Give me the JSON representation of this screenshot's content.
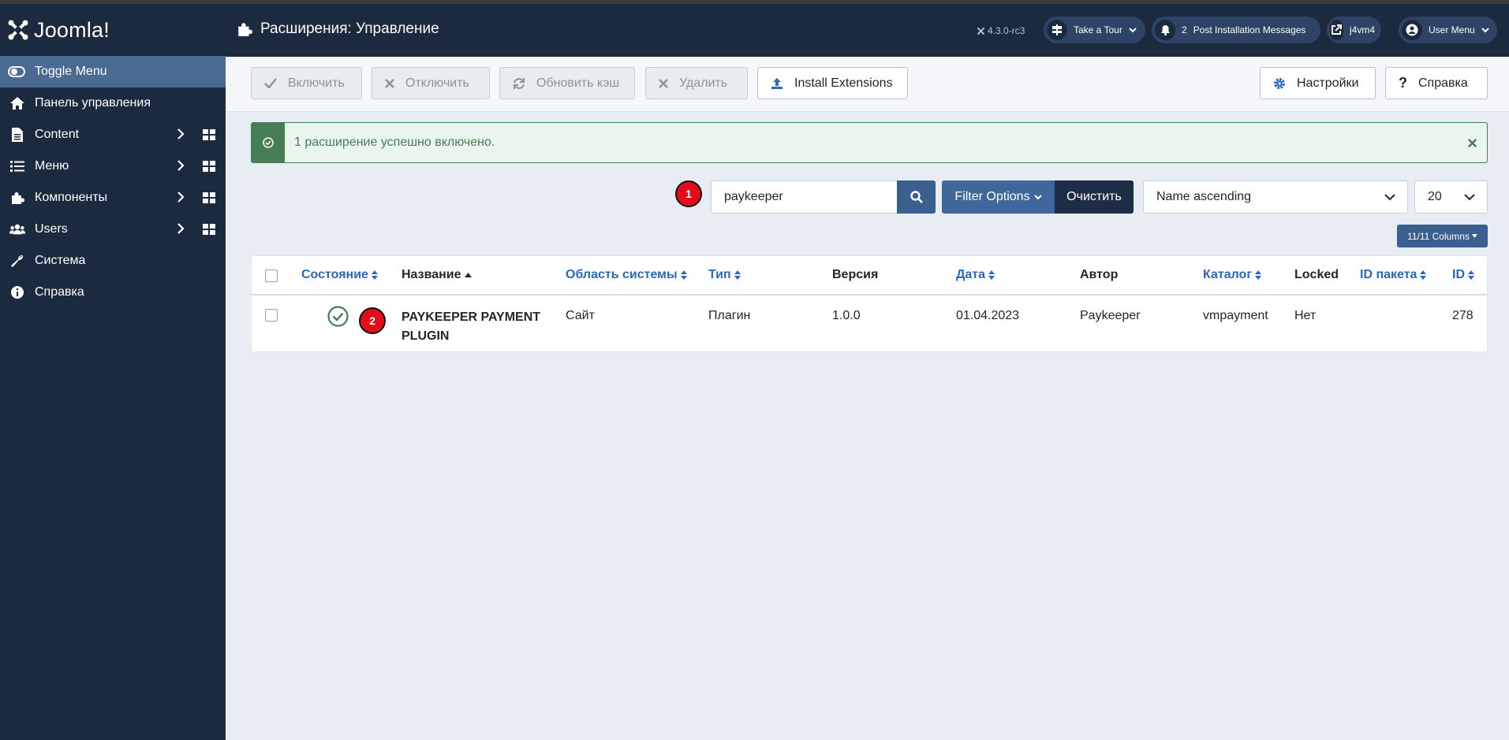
{
  "app": {
    "logo_text": "Joomla!",
    "page_title": "Расширения: Управление",
    "version": "4.3.0-rc3"
  },
  "header_buttons": {
    "tour": "Take a Tour",
    "notifications_count": "2",
    "post_install": "Post Installation Messages",
    "site_name": "j4vm4",
    "user_menu": "User Menu"
  },
  "sidebar": {
    "toggle": "Toggle Menu",
    "items": [
      {
        "label": "Панель управления",
        "icon": "home-icon"
      },
      {
        "label": "Content",
        "icon": "file-icon"
      },
      {
        "label": "Меню",
        "icon": "list-icon"
      },
      {
        "label": "Компоненты",
        "icon": "puzzle-icon"
      },
      {
        "label": "Users",
        "icon": "users-icon"
      },
      {
        "label": "Система",
        "icon": "wrench-icon"
      },
      {
        "label": "Справка",
        "icon": "info-icon"
      }
    ]
  },
  "toolbar": {
    "enable": "Включить",
    "disable": "Отключить",
    "refresh_cache": "Обновить кэш",
    "delete": "Удалить",
    "install": "Install Extensions",
    "options": "Настройки",
    "help": "Справка"
  },
  "alert": {
    "message": "1 расширение успешно включено.",
    "close": "×"
  },
  "filters": {
    "search_value": "paykeeper",
    "filter_options": "Filter Options",
    "clear": "Очистить",
    "ordering": "Name ascending",
    "limit": "20",
    "columns": "11/11 Columns"
  },
  "badges": {
    "one": "1",
    "two": "2"
  },
  "table": {
    "headers": {
      "state": "Состояние",
      "name": "Название",
      "client": "Область системы",
      "type": "Тип",
      "version": "Версия",
      "date": "Дата",
      "author": "Автор",
      "folder": "Каталог",
      "locked": "Locked",
      "package_id": "ID пакета",
      "id": "ID"
    },
    "rows": [
      {
        "name_line1": "PAYKEEPER PAYMENT",
        "name_line2": "PLUGIN",
        "client": "Сайт",
        "type": "Плагин",
        "version": "1.0.0",
        "date": "01.04.2023",
        "author": "Paykeeper",
        "folder": "vmpayment",
        "locked": "Нет",
        "package_id": "",
        "id": "278"
      }
    ]
  },
  "colors": {
    "sidebar_bg": "#1c2a3f",
    "toggle_bg": "#4a6a94",
    "success": "#457d54",
    "link": "#2a69b8",
    "badge": "#e30d17"
  }
}
